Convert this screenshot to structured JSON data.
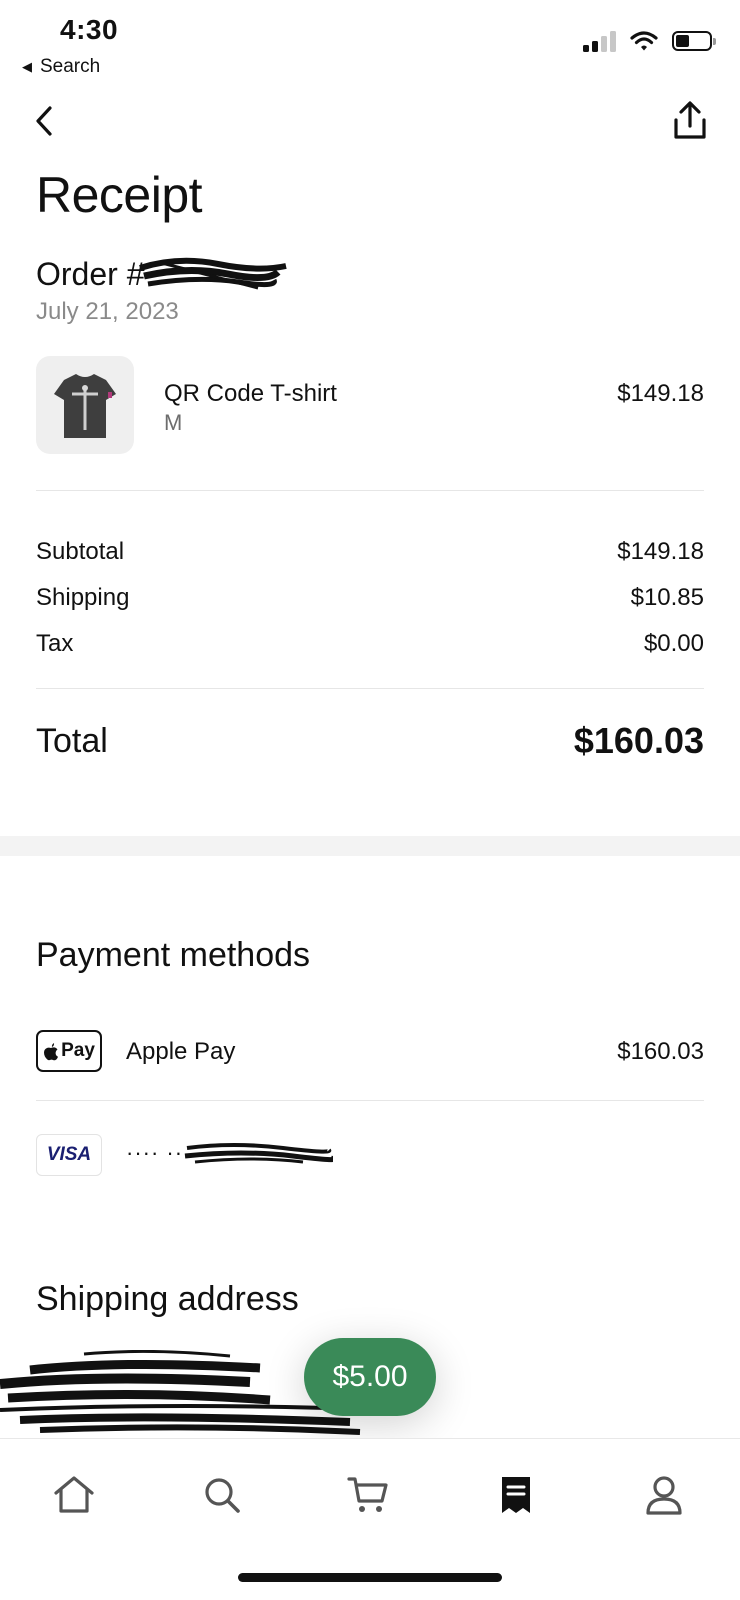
{
  "status_bar": {
    "time": "4:30",
    "back_label": "Search",
    "back_icon": "left-triangle-icon",
    "icons": [
      "cellular-signal-icon",
      "wifi-icon",
      "battery-icon"
    ]
  },
  "nav": {
    "back_icon": "chevron-left-icon",
    "share_icon": "share-icon"
  },
  "page": {
    "title": "Receipt",
    "order_label": "Order #",
    "order_date": "July 21, 2023"
  },
  "item": {
    "name": "QR Code T-shirt",
    "size": "M",
    "price": "$149.18",
    "thumbnail_icon": "tshirt-thumbnail"
  },
  "summary": {
    "rows": [
      {
        "label": "Subtotal",
        "value": "$149.18"
      },
      {
        "label": "Shipping",
        "value": "$10.85"
      },
      {
        "label": "Tax",
        "value": "$0.00"
      }
    ],
    "total_label": "Total",
    "total_value": "$160.03"
  },
  "payment": {
    "title": "Payment methods",
    "apple_pay_badge": "Pay",
    "apple_pay_name": "Apple Pay",
    "apple_pay_amount": "$160.03",
    "visa_badge": "VISA",
    "card_mask": "···· ··"
  },
  "shipping": {
    "title": "Shipping address"
  },
  "tip": {
    "label": "$5.00",
    "color": "#3a8a58"
  },
  "tabbar": {
    "items": [
      {
        "name": "home",
        "icon": "home-icon"
      },
      {
        "name": "search",
        "icon": "search-icon"
      },
      {
        "name": "cart",
        "icon": "cart-icon"
      },
      {
        "name": "orders",
        "icon": "receipt-icon",
        "active": true
      },
      {
        "name": "profile",
        "icon": "person-icon"
      }
    ]
  }
}
